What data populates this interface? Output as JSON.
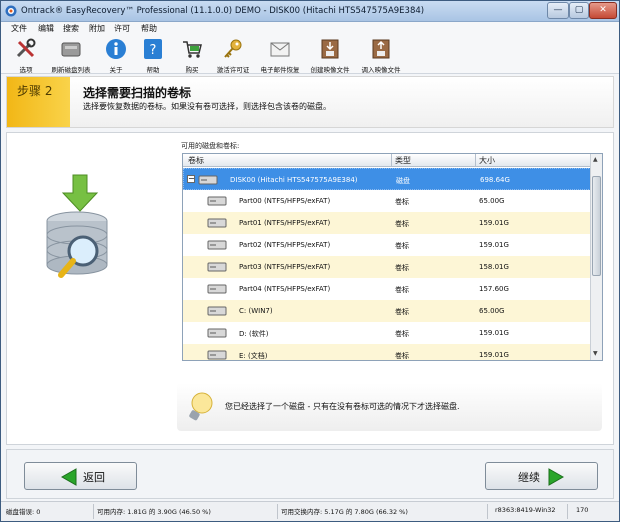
{
  "window": {
    "title": "Ontrack® EasyRecovery™ Professional (11.1.0.0) DEMO - DISK00 (Hitachi HTS547575A9E384)",
    "controls": {
      "minimize": "—",
      "maximize": "▢",
      "close": "✕"
    }
  },
  "menu": [
    "文件",
    "编辑",
    "搜索",
    "附加",
    "许可",
    "帮助"
  ],
  "toolbar": [
    {
      "label": "选项",
      "icon": "tools-icon"
    },
    {
      "label": "刷新磁盘列表",
      "icon": "refresh-disk-icon"
    },
    {
      "label": "关于",
      "icon": "info-icon"
    },
    {
      "label": "帮助",
      "icon": "help-icon"
    },
    {
      "label": "购买",
      "icon": "cart-icon"
    },
    {
      "label": "激活许可证",
      "icon": "key-icon"
    },
    {
      "label": "电子邮件恢复",
      "icon": "mail-icon"
    },
    {
      "label": "创建映像文件",
      "icon": "create-image-icon"
    },
    {
      "label": "调入映像文件",
      "icon": "load-image-icon"
    }
  ],
  "step": {
    "badge": "步骤 2",
    "title": "选择需要扫描的卷标",
    "description": "选择要恢复数据的卷标。如果没有卷可选择，则选择包含该卷的磁盘。"
  },
  "volume_list": {
    "label": "可用的磁盘和卷标:",
    "columns": {
      "name": "卷标",
      "type": "类型",
      "size": "大小"
    },
    "rows": [
      {
        "name": "DISK00 (Hitachi HTS547575A9E384)",
        "type": "磁盘",
        "size": "698.64G",
        "level": 0,
        "selected": true
      },
      {
        "name": "Part00 (NTFS/HFPS/exFAT)",
        "type": "卷标",
        "size": "65.00G",
        "level": 1
      },
      {
        "name": "Part01 (NTFS/HFPS/exFAT)",
        "type": "卷标",
        "size": "159.01G",
        "level": 1
      },
      {
        "name": "Part02 (NTFS/HFPS/exFAT)",
        "type": "卷标",
        "size": "159.01G",
        "level": 1
      },
      {
        "name": "Part03 (NTFS/HFPS/exFAT)",
        "type": "卷标",
        "size": "158.01G",
        "level": 1
      },
      {
        "name": "Part04 (NTFS/HFPS/exFAT)",
        "type": "卷标",
        "size": "157.60G",
        "level": 1
      },
      {
        "name": "C: (WIN7)",
        "type": "卷标",
        "size": "65.00G",
        "level": 1
      },
      {
        "name": "D: (软件)",
        "type": "卷标",
        "size": "159.01G",
        "level": 1
      },
      {
        "name": "E: (文档)",
        "type": "卷标",
        "size": "159.01G",
        "level": 1
      }
    ]
  },
  "info": {
    "message": "您已经选择了一个磁盘 - 只有在没有卷标可选的情况下才选择磁盘."
  },
  "navigation": {
    "back": "返回",
    "next": "继续"
  },
  "status": {
    "disk_errors": "磁盘错误: 0",
    "memory": "可用内存: 1.81G 的 3.90G (46.50 %)",
    "swap": "可用交换内存: 5.17G 的 7.80G (66.32 %)",
    "build": "r8363:8419-Win32",
    "counter": "170"
  },
  "colors": {
    "step_accent": "#f2b716",
    "selection": "#3e8fe6",
    "alt_row": "#fdf6d6",
    "nav_arrow": "#2aa52a"
  }
}
